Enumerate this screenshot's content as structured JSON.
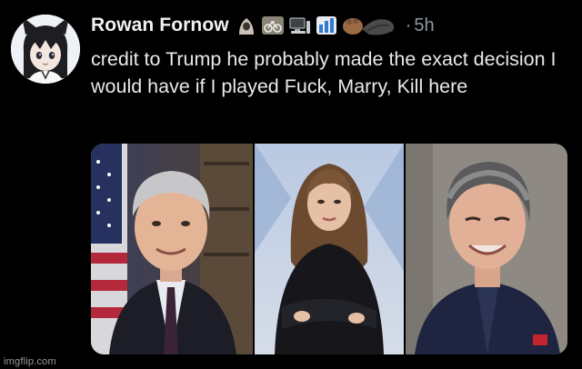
{
  "post": {
    "author_name": "Rowan Fornow",
    "separator": "·",
    "time_ago": "5h",
    "text": "credit to Trump he probably made the exact decision I would have if I played Fuck, Marry, Kill here",
    "emoji_icons": [
      "hooded-figure-emoji",
      "bicycle-emoji",
      "computer-emoji",
      "chart-emoji",
      "hands-emoji"
    ],
    "media": [
      {
        "icon": "photo-man-in-suit"
      },
      {
        "icon": "photo-woman-arms-crossed"
      },
      {
        "icon": "photo-man-smiling"
      }
    ]
  },
  "watermark": "imgflip.com",
  "colors": {
    "background": "#000000",
    "text": "#e7e9ea",
    "muted": "#8b98a5"
  }
}
